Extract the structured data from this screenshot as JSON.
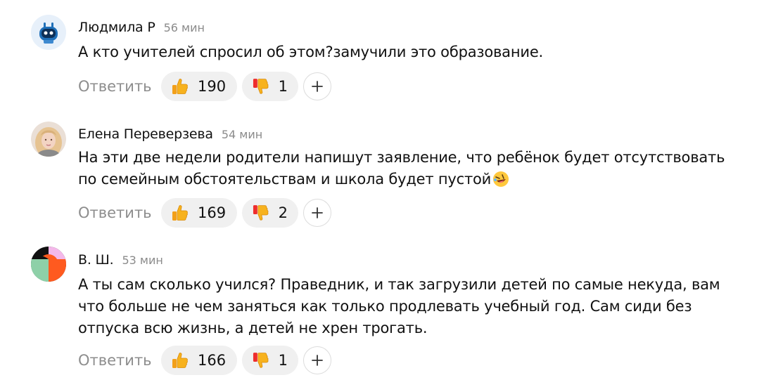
{
  "comments": [
    {
      "author": "Людмила Р",
      "time": "56 мин",
      "lines": [
        "А кто учителей спросил об этом?замучили это образование."
      ],
      "reply_label": "Ответить",
      "likes": "190",
      "dislikes": "1"
    },
    {
      "author": "Елена Переверзева",
      "time": "54 мин",
      "lines": [
        "На эти две недели родители напишут заявление, что ребёнок будет отсутствовать",
        "по семейным обстоятельствам и школа будет пустой"
      ],
      "reply_label": "Ответить",
      "likes": "169",
      "dislikes": "2"
    },
    {
      "author": "В. Ш.",
      "time": "53 мин",
      "lines": [
        "А ты сам сколько учился? Праведник, и так загрузили детей по самые некуда, вам",
        "что больше не чем заняться как только продлевать учебный год. Сам сиди без",
        "отпуска всю жизнь, а детей не хрен трогать."
      ],
      "reply_label": "Ответить",
      "likes": "166",
      "dislikes": "1"
    }
  ],
  "icons": {
    "like": "thumbs-up-icon",
    "dislike": "thumbs-down-icon",
    "add_reaction": "plus-icon",
    "emoji": "rolling-laughing-emoji"
  },
  "colors": {
    "pill_bg": "#f0f0f0",
    "muted_text": "#8d8d8d",
    "thumb_yellow": "#f7b21e",
    "thumb_red": "#ee2d2d"
  }
}
